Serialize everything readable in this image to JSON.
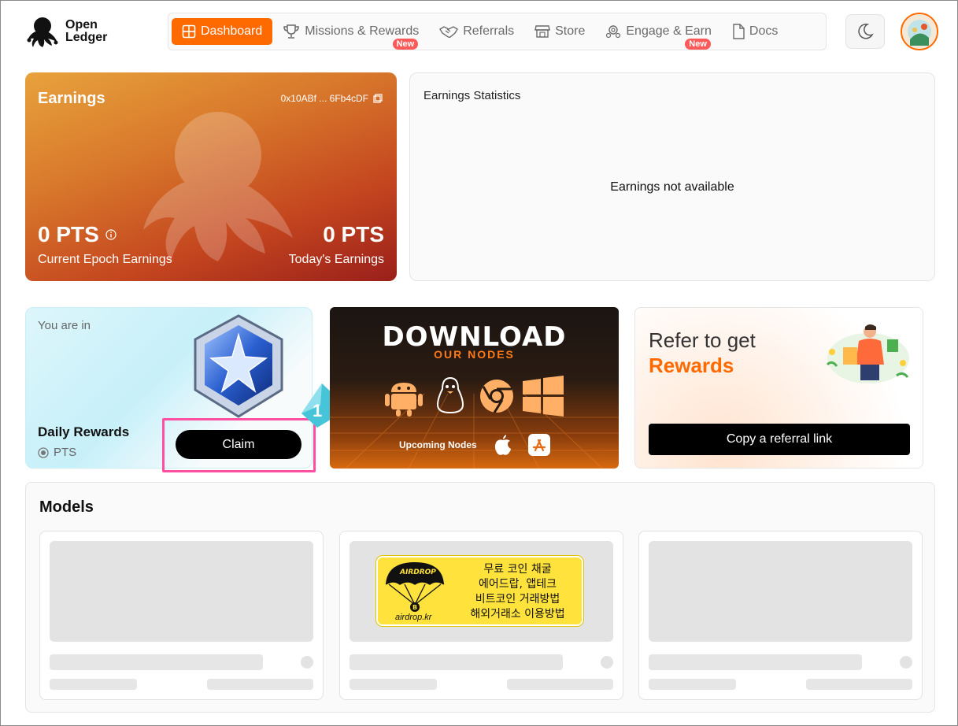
{
  "header": {
    "logo_line1": "Open",
    "logo_line2": "Ledger",
    "nav": [
      {
        "label": "Dashboard",
        "icon": "grid-icon",
        "active": true
      },
      {
        "label": "Missions & Rewards",
        "icon": "trophy-icon",
        "badge": "New"
      },
      {
        "label": "Referrals",
        "icon": "handshake-icon"
      },
      {
        "label": "Store",
        "icon": "store-icon"
      },
      {
        "label": "Engage & Earn",
        "icon": "gear-people-icon",
        "badge": "New"
      },
      {
        "label": "Docs",
        "icon": "document-icon"
      }
    ]
  },
  "earnings": {
    "title": "Earnings",
    "address": "0x10ABf ... 6Fb4cDF",
    "epoch_value": "0 PTS",
    "epoch_label": "Current Epoch Earnings",
    "today_value": "0 PTS",
    "today_label": "Today's Earnings"
  },
  "stats": {
    "title": "Earnings Statistics",
    "empty": "Earnings not available"
  },
  "daily": {
    "you_are_in": "You are in",
    "title": "Daily Rewards",
    "pts": "PTS",
    "claim": "Claim",
    "step_number": "1"
  },
  "download": {
    "title": "DOWNLOAD",
    "subtitle": "OUR NODES",
    "upcoming": "Upcoming Nodes"
  },
  "refer": {
    "line1": "Refer to get",
    "line2": "Rewards",
    "button": "Copy a referral link"
  },
  "models": {
    "title": "Models"
  },
  "airdrop": {
    "badge": "AIRDROP",
    "lines": [
      "무료 코인 채굴",
      "에어드랍, 앱테크",
      "비트코인 거래방법",
      "해외거래소 이용방법"
    ],
    "url": "airdrop.kr"
  },
  "colors": {
    "accent": "#ff6a00",
    "new_badge": "#ff5a5a",
    "highlight": "#ff4fa3"
  }
}
